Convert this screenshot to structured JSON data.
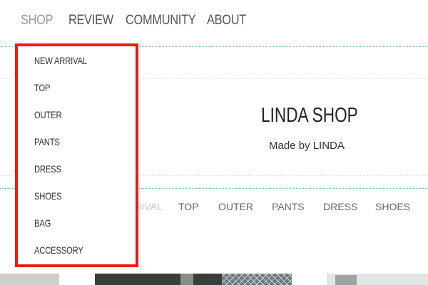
{
  "nav": {
    "items": [
      {
        "label": "SHOP",
        "active": true
      },
      {
        "label": "REVIEW",
        "active": false
      },
      {
        "label": "COMMUNITY",
        "active": false
      },
      {
        "label": "ABOUT",
        "active": false
      }
    ]
  },
  "dropdown": {
    "items": [
      "NEW ARRIVAL",
      "TOP",
      "OUTER",
      "PANTS",
      "DRESS",
      "SHOES",
      "BAG",
      "ACCESSORY"
    ],
    "highlight_color": "#f01a0f"
  },
  "hero": {
    "title": "LINDA SHOP",
    "subtitle": "Made by LINDA"
  },
  "category_bar": {
    "items": [
      "NEW ARRIVAL",
      "TOP",
      "OUTER",
      "PANTS",
      "DRESS",
      "SHOES"
    ]
  },
  "colors": {
    "separator": "#7fb0c6",
    "nav_text": "#555555",
    "nav_active_text": "#9a9a9a"
  }
}
